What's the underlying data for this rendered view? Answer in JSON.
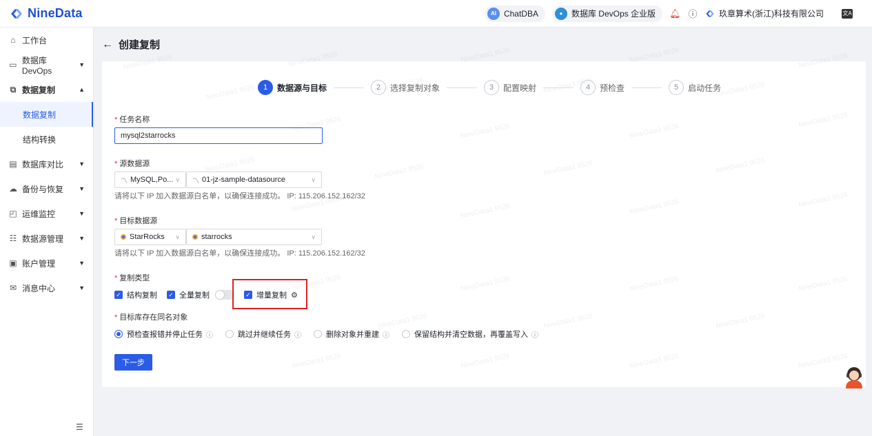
{
  "brand": {
    "name": "NineData"
  },
  "topbar": {
    "chatdba_label": "ChatDBA",
    "chatdba_icon_text": "AI",
    "edition_label": "数据库 DevOps 企业版",
    "company_name": "玖章算术(浙江)科技有限公司",
    "lang_icon_text": "文A"
  },
  "sidebar": {
    "items": [
      {
        "label": "工作台",
        "icon": "home-icon"
      },
      {
        "label": "数据库 DevOps",
        "icon": "devops-icon"
      },
      {
        "label": "数据复制",
        "icon": "replicate-icon"
      },
      {
        "label": "数据复制",
        "icon": ""
      },
      {
        "label": "结构转换",
        "icon": ""
      },
      {
        "label": "数据库对比",
        "icon": "compare-icon"
      },
      {
        "label": "备份与恢复",
        "icon": "backup-icon"
      },
      {
        "label": "运维监控",
        "icon": "monitor-icon"
      },
      {
        "label": "数据源管理",
        "icon": "datasource-icon"
      },
      {
        "label": "账户管理",
        "icon": "account-icon"
      },
      {
        "label": "消息中心",
        "icon": "message-icon"
      }
    ]
  },
  "page": {
    "title": "创建复制"
  },
  "steps": [
    {
      "num": "1",
      "label": "数据源与目标"
    },
    {
      "num": "2",
      "label": "选择复制对象"
    },
    {
      "num": "3",
      "label": "配置映射"
    },
    {
      "num": "4",
      "label": "预检查"
    },
    {
      "num": "5",
      "label": "启动任务"
    }
  ],
  "form": {
    "task_name_label": "任务名称",
    "task_name_value": "mysql2starrocks",
    "source_label": "源数据源",
    "source_type": "MySQL,Po...",
    "source_name": "01-jz-sample-datasource",
    "source_hint": "请将以下 IP 加入数据源白名单，以确保连接成功。 IP: 115.206.152.162/32",
    "target_label": "目标数据源",
    "target_type": "StarRocks",
    "target_name": "starrocks",
    "target_hint": "请将以下 IP 加入数据源白名单，以确保连接成功。 IP: 115.206.152.162/32",
    "replication_type_label": "复制类型",
    "opt_schema": "结构复制",
    "opt_full": "全量复制",
    "opt_incremental": "增量复制",
    "conflict_label": "目标库存在同名对象",
    "conflict_options": [
      "预检查报错并停止任务",
      "跳过并继续任务",
      "删除对象并重建",
      "保留结构并清空数据，再覆盖写入"
    ],
    "next_button": "下一步"
  },
  "watermark": "NineData1 9526"
}
